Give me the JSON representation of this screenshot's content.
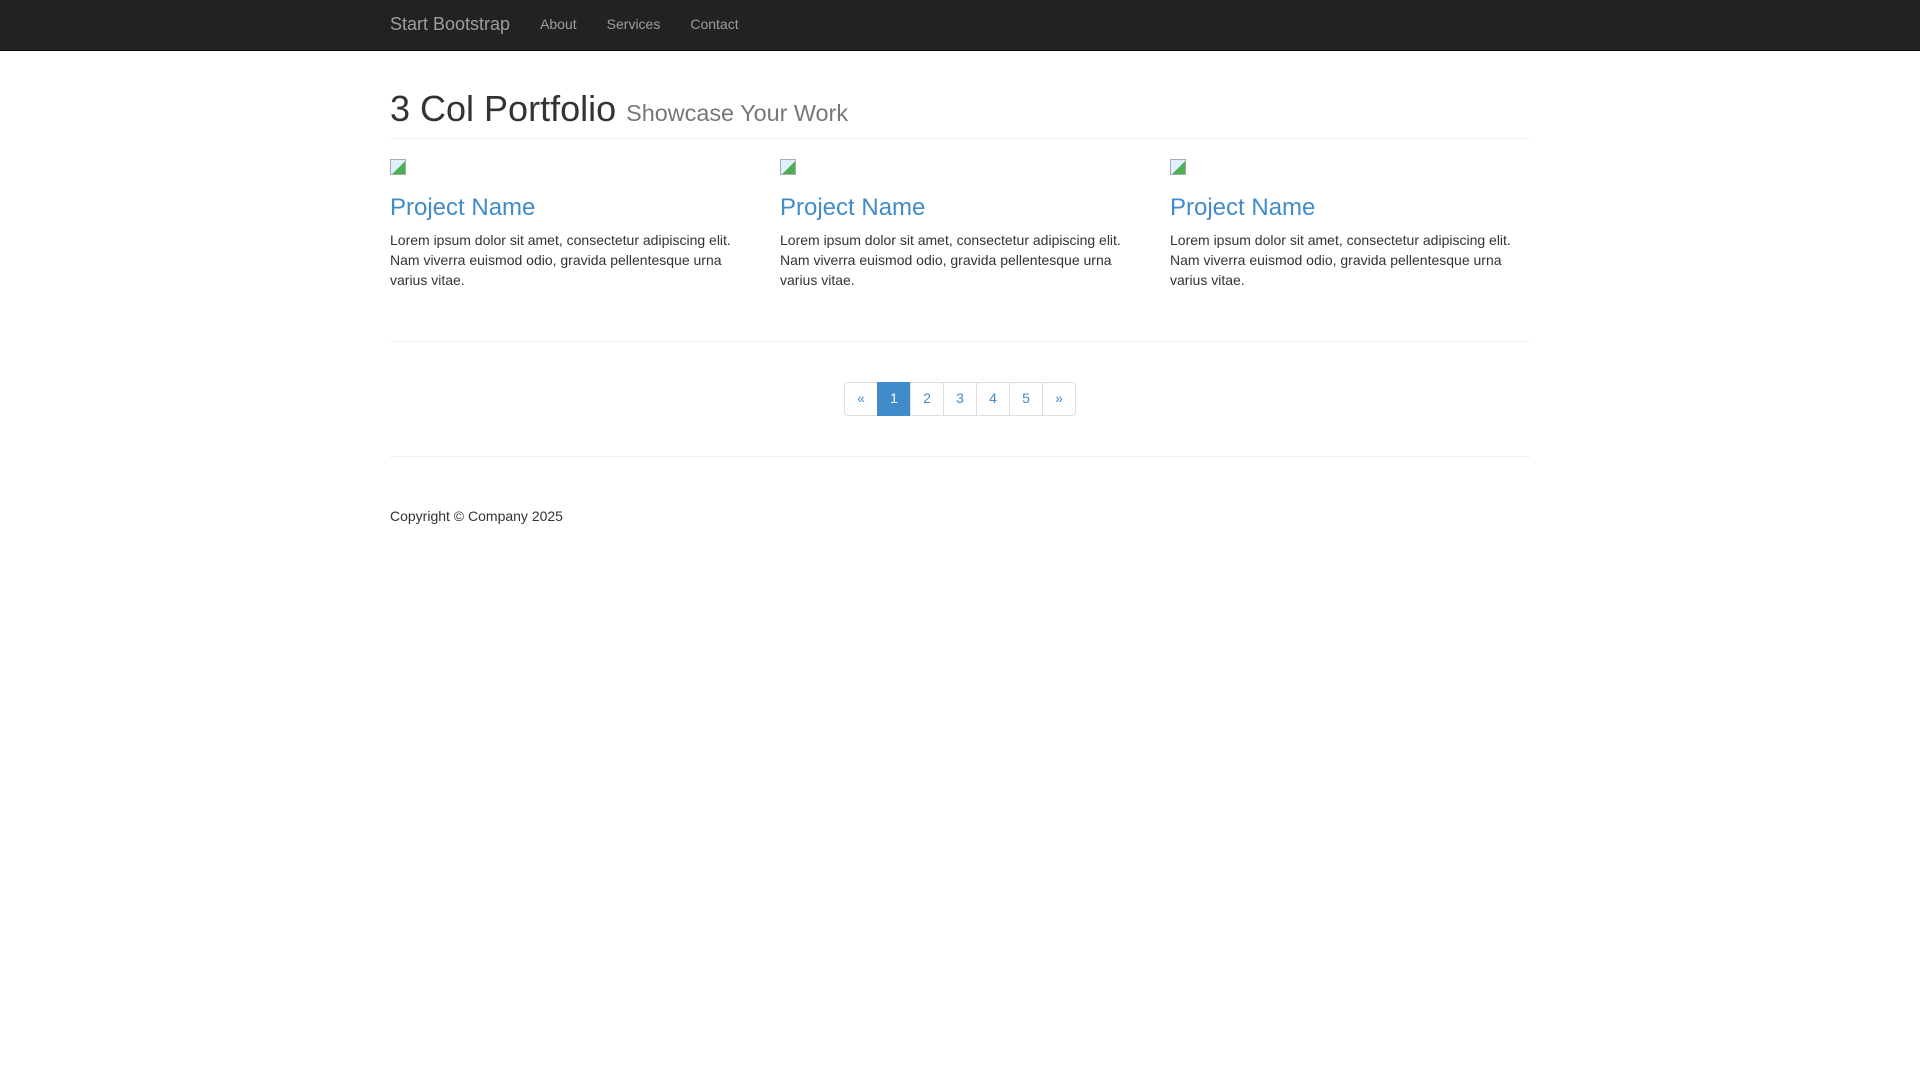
{
  "navbar": {
    "brand": "Start Bootstrap",
    "links": [
      "About",
      "Services",
      "Contact"
    ]
  },
  "header": {
    "title": "3 Col Portfolio",
    "subtitle": "Showcase Your Work"
  },
  "projects": [
    {
      "title": "Project Name",
      "text": "Lorem ipsum dolor sit amet, consectetur adipiscing elit. Nam viverra euismod odio, gravida pellentesque urna varius vitae."
    },
    {
      "title": "Project Name",
      "text": "Lorem ipsum dolor sit amet, consectetur adipiscing elit. Nam viverra euismod odio, gravida pellentesque urna varius vitae."
    },
    {
      "title": "Project Name",
      "text": "Lorem ipsum dolor sit amet, consectetur adipiscing elit. Nam viverra euismod odio, gravida pellentesque urna varius vitae."
    }
  ],
  "pagination": {
    "prev": "«",
    "pages": [
      "1",
      "2",
      "3",
      "4",
      "5"
    ],
    "next": "»",
    "active": "1"
  },
  "footer": {
    "copyright": "Copyright © Company 2025"
  },
  "colors": {
    "accent": "#428bca",
    "navbar": "#222222"
  }
}
